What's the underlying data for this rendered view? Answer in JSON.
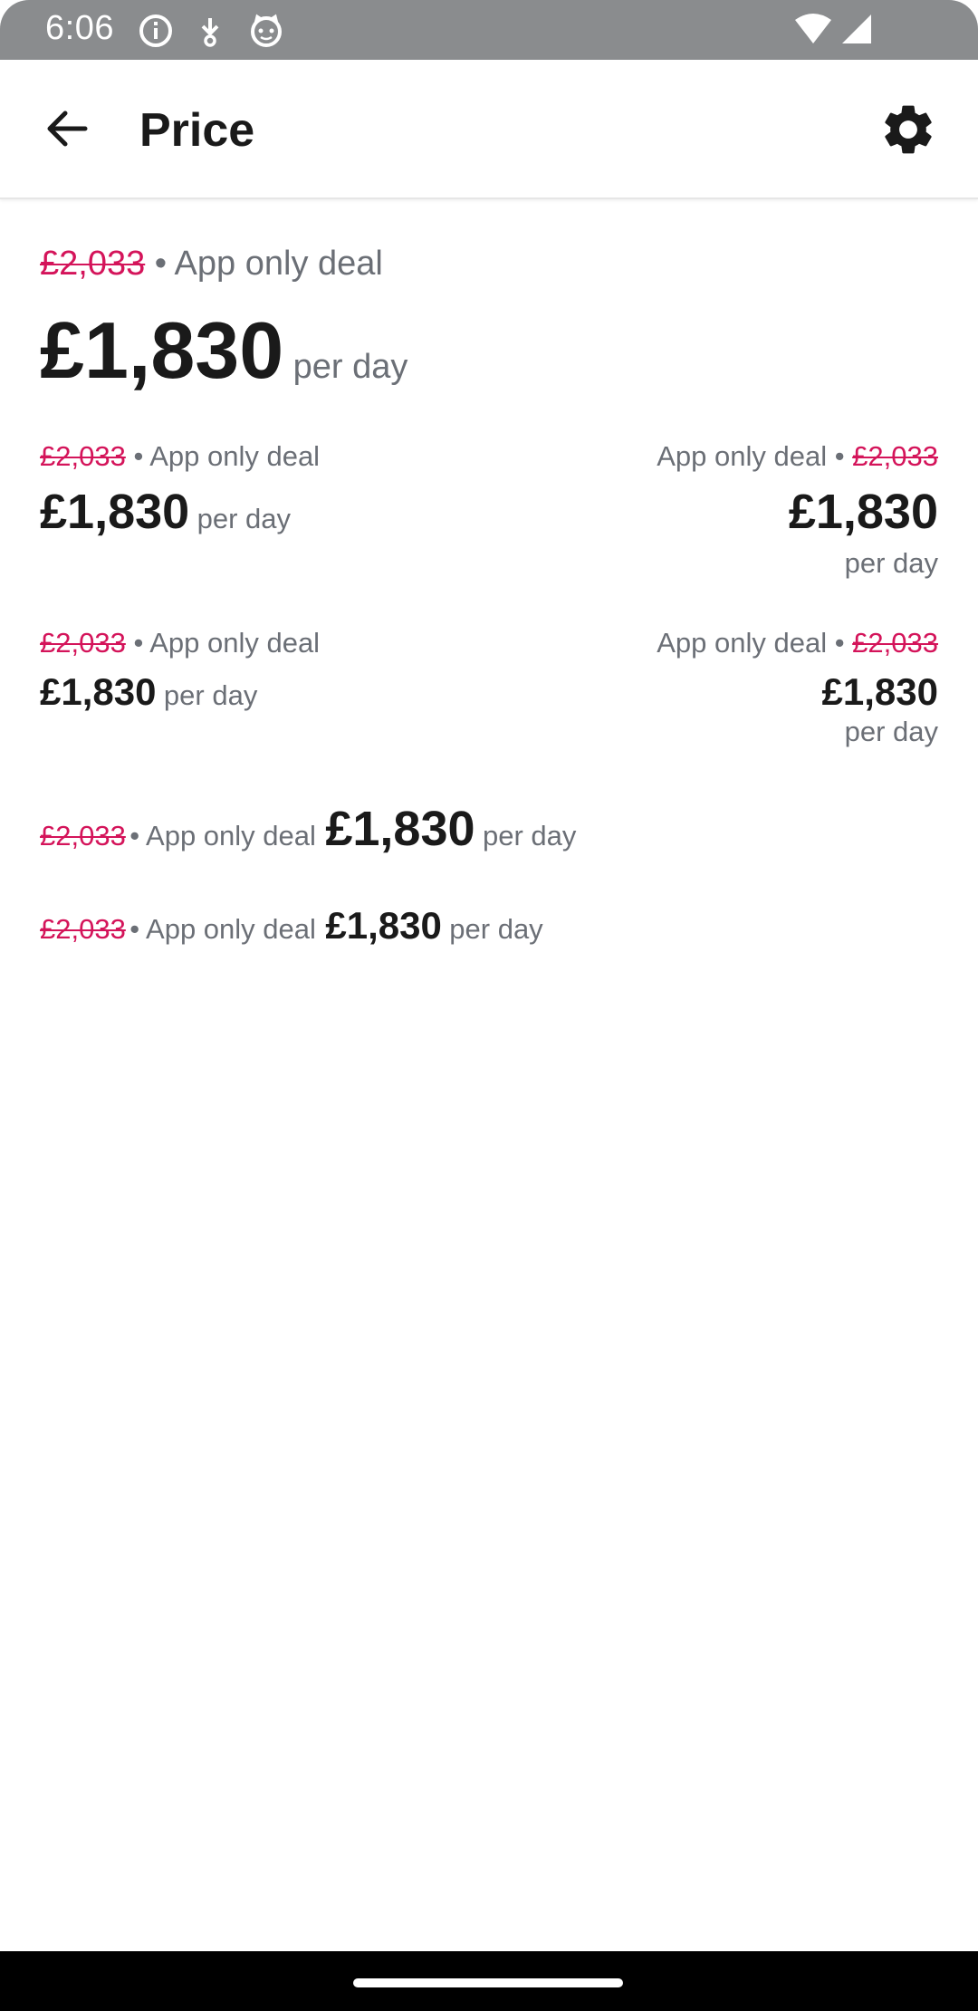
{
  "status_bar": {
    "time": "6:06",
    "icons": [
      "info-icon",
      "download-icon",
      "cat-face-icon",
      "wifi-icon",
      "cell-signal-icon"
    ]
  },
  "app_bar": {
    "title": "Price",
    "back_icon": "arrow-back-icon",
    "settings_icon": "gear-icon"
  },
  "colors": {
    "strikethrough": "#d4145a",
    "muted_text": "#6b6f76",
    "price_text": "#1a1a1a"
  },
  "variants": {
    "large": {
      "old_price": "£2,033",
      "deal": "• App only deal",
      "price": "£1,830",
      "unit": "per day"
    },
    "medium_left": {
      "old_price": "£2,033",
      "deal": "• App only deal",
      "price": "£1,830",
      "unit": "per day"
    },
    "medium_right": {
      "deal": "App only deal •",
      "old_price": "£2,033",
      "price": "£1,830",
      "unit": "per day"
    },
    "small_left": {
      "old_price": "£2,033",
      "deal": "• App only deal",
      "price": "£1,830",
      "unit": "per day"
    },
    "small_right": {
      "deal": "App only deal •",
      "old_price": "£2,033",
      "price": "£1,830",
      "unit": "per day"
    },
    "inline_medium": {
      "old_price": "£2,033",
      "deal": "• App only deal",
      "price": "£1,830",
      "unit": "per day"
    },
    "inline_small": {
      "old_price": "£2,033",
      "deal": "• App only deal",
      "price": "£1,830",
      "unit": "per day"
    }
  }
}
